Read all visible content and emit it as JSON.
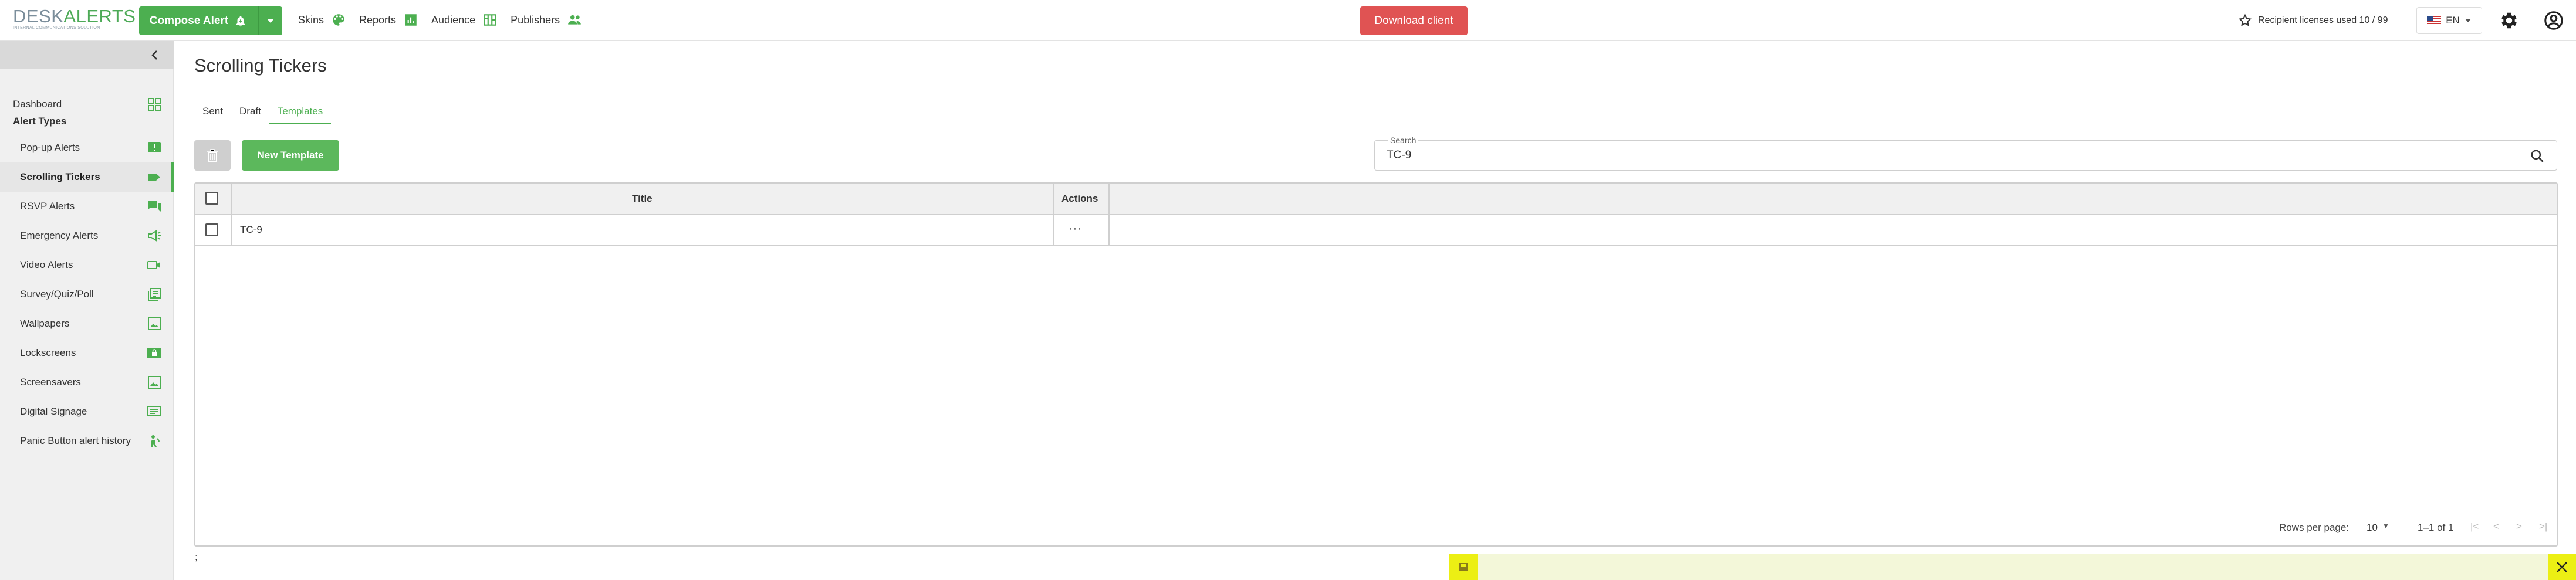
{
  "brand": {
    "logo_desk": "DESK",
    "logo_alerts": "ALERTS",
    "logo_tagline": "INTERNAL COMMUNICATIONS SOLUTION"
  },
  "header": {
    "compose_label": "Compose Alert",
    "nav": [
      {
        "label": "Skins",
        "icon": "palette-icon"
      },
      {
        "label": "Reports",
        "icon": "chart-icon"
      },
      {
        "label": "Audience",
        "icon": "org-chart-icon"
      },
      {
        "label": "Publishers",
        "icon": "people-icon"
      }
    ],
    "download_label": "Download client",
    "licenses_label": "Recipient licenses used 10 / 99",
    "language": "EN"
  },
  "sidebar": {
    "dashboard": "Dashboard",
    "section_title": "Alert Types",
    "items": [
      {
        "label": "Pop-up Alerts",
        "icon": "popup-icon"
      },
      {
        "label": "Scrolling Tickers",
        "icon": "ticker-icon",
        "active": true
      },
      {
        "label": "RSVP Alerts",
        "icon": "chat-icon"
      },
      {
        "label": "Emergency Alerts",
        "icon": "megaphone-icon"
      },
      {
        "label": "Video Alerts",
        "icon": "video-icon"
      },
      {
        "label": "Survey/Quiz/Poll",
        "icon": "survey-icon"
      },
      {
        "label": "Wallpapers",
        "icon": "wallpaper-icon"
      },
      {
        "label": "Lockscreens",
        "icon": "lockscreen-icon"
      },
      {
        "label": "Screensavers",
        "icon": "screensaver-icon"
      },
      {
        "label": "Digital Signage",
        "icon": "signage-icon"
      },
      {
        "label": "Panic Button alert history",
        "icon": "panic-icon"
      }
    ]
  },
  "main": {
    "title": "Scrolling Tickers",
    "tabs": [
      {
        "label": "Sent"
      },
      {
        "label": "Draft"
      },
      {
        "label": "Templates",
        "active": true
      }
    ],
    "new_template_label": "New Template",
    "search": {
      "label": "Search",
      "value": "TC-9"
    },
    "table": {
      "columns": {
        "title": "Title",
        "actions": "Actions"
      },
      "rows": [
        {
          "title": "TC-9",
          "actions": "···"
        }
      ]
    },
    "pagination": {
      "rows_per_page_label": "Rows per page:",
      "rows_per_page": "10",
      "range": "1–1 of 1"
    },
    "footer_text": ";"
  },
  "colors": {
    "accent": "#4caf50",
    "danger": "#e05353",
    "banner": "#ecef14"
  }
}
